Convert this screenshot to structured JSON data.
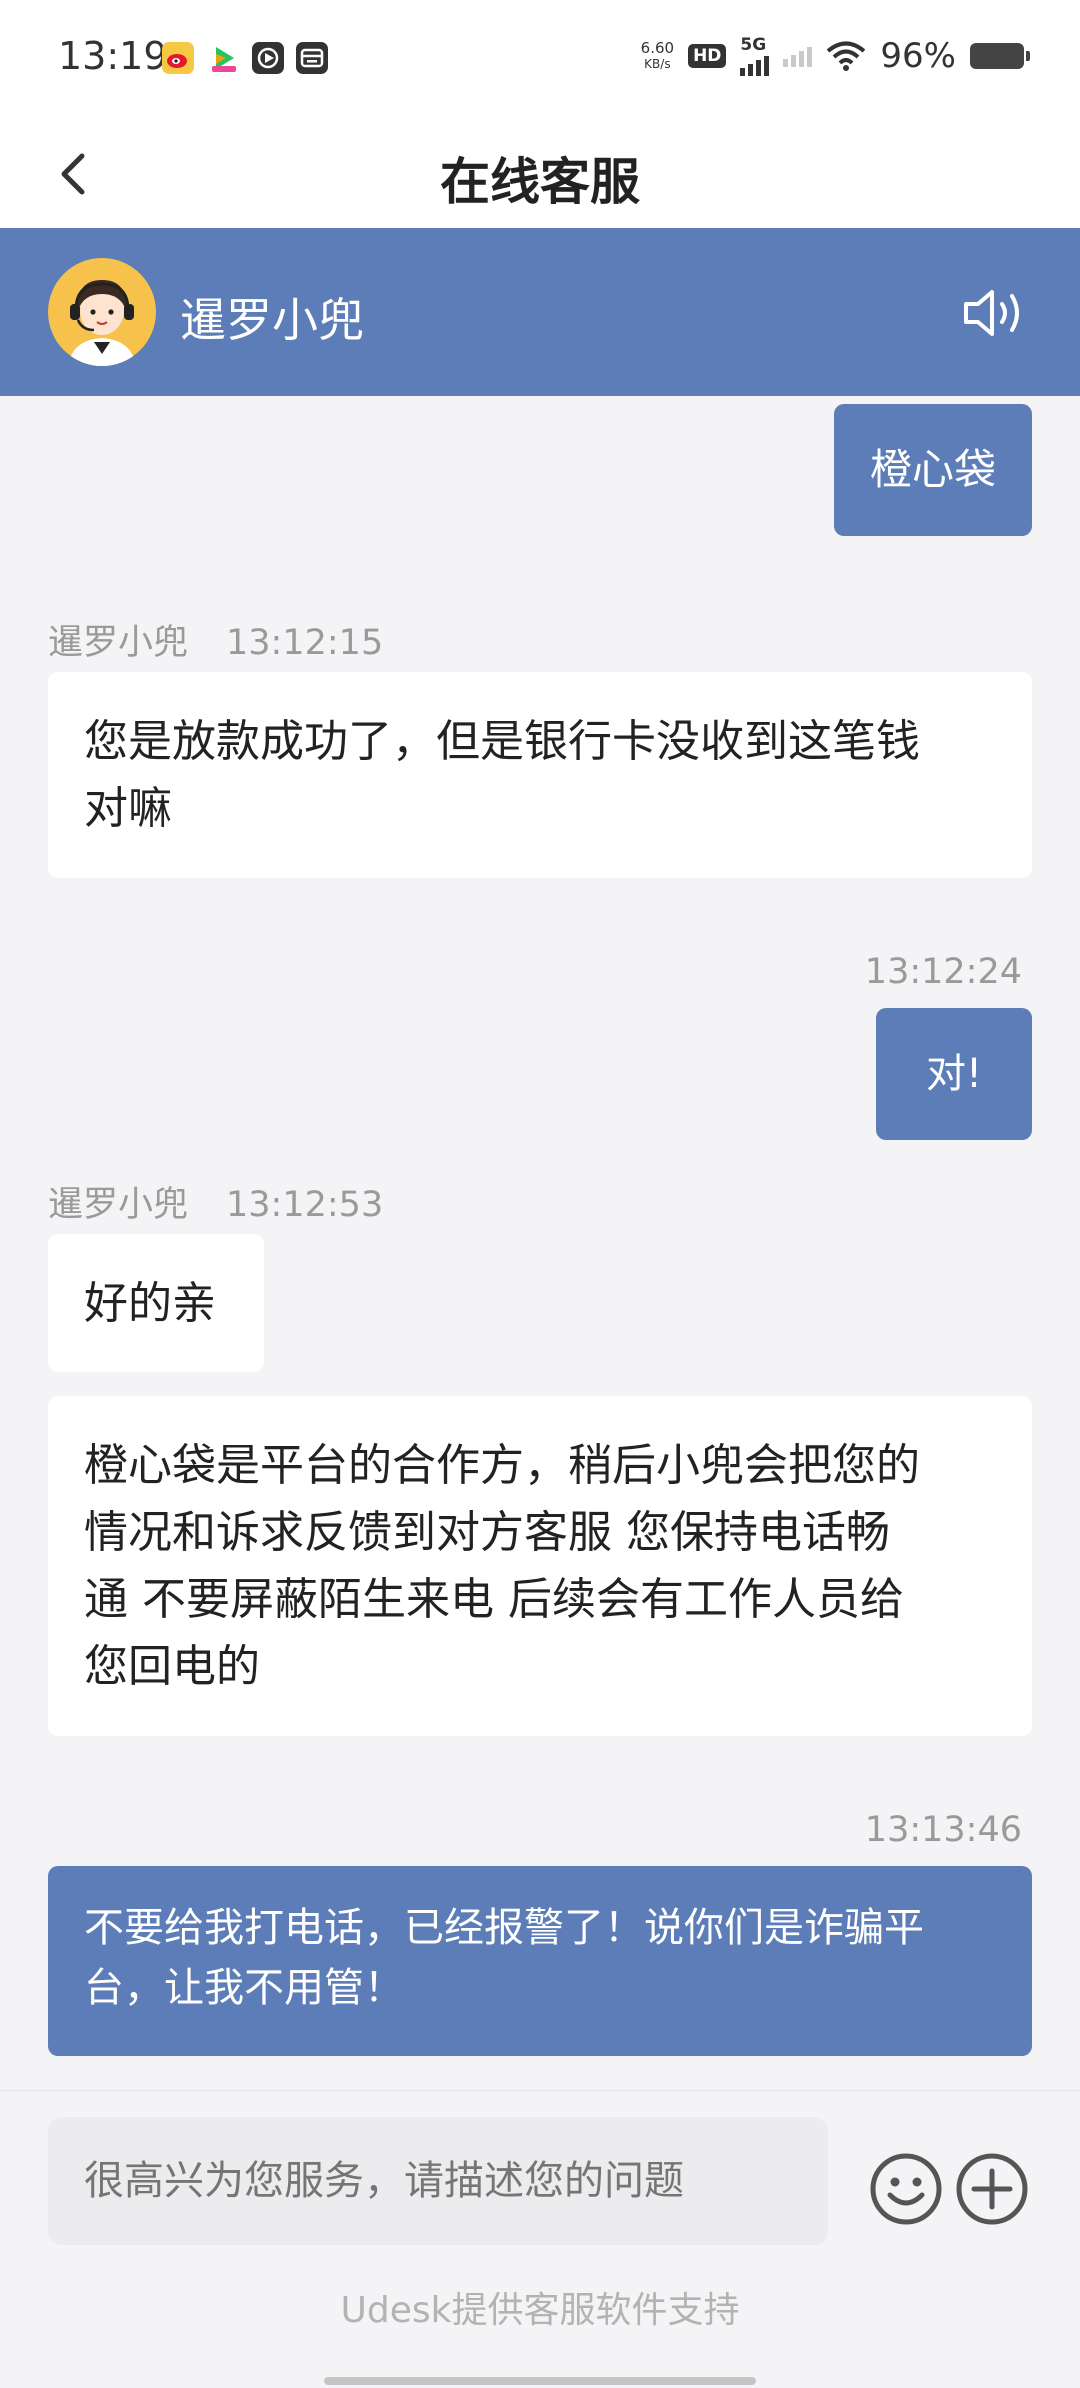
{
  "status_bar": {
    "time": "13:19",
    "net_speed_value": "6.60",
    "net_speed_unit": "KB/s",
    "hd": "HD",
    "network": "5G",
    "battery": "96%"
  },
  "nav": {
    "title": "在线客服",
    "back_icon": "chevron-left-icon"
  },
  "agent": {
    "name": "暹罗小兜",
    "avatar_icon": "agent-avatar",
    "speaker_icon": "speaker-icon"
  },
  "messages": [
    {
      "from": "user",
      "text": "橙心袋"
    },
    {
      "from": "agent",
      "name": "暹罗小兜",
      "time": "13:12:15",
      "lines": [
        "您是放款成功了，但是银行卡没收到这笔钱",
        "对嘛"
      ]
    },
    {
      "from": "user",
      "time": "13:12:24",
      "text": "对!"
    },
    {
      "from": "agent",
      "name": "暹罗小兜",
      "time": "13:12:53",
      "text": "好的亲"
    },
    {
      "from": "agent",
      "lines": [
        "橙心袋是平台的合作方，稍后小兜会把您的",
        "情况和诉求反馈到对方客服 您保持电话畅",
        "通 不要屏蔽陌生来电 后续会有工作人员给",
        "您回电的"
      ]
    },
    {
      "from": "user",
      "time": "13:13:46",
      "lines": [
        "不要给我打电话，已经报警了！说你们是诈骗平",
        "台，让我不用管！"
      ]
    }
  ],
  "input": {
    "placeholder": "很高兴为您服务，请描述您的问题",
    "emoji_icon": "smiley-icon",
    "plus_icon": "plus-circle-icon"
  },
  "footer": {
    "powered_by": "Udesk提供客服软件支持"
  },
  "colors": {
    "brand": "#5d7db8",
    "background": "#f4f4f6"
  }
}
